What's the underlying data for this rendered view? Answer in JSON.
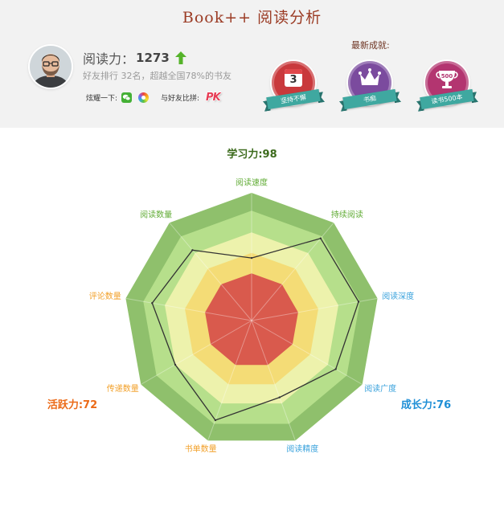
{
  "app": {
    "title": "Book++ 阅读分析"
  },
  "profile": {
    "avatar": "user-avatar-photo",
    "score_label": "阅读力：",
    "score_value": "1273",
    "trend_icon": "arrow-up-icon",
    "trend_color": "#55b32a",
    "rank_text": "好友排行 32名，超越全国78%的书友",
    "share_label": "炫耀一下:",
    "share_icons": [
      "wechat-icon",
      "moments-icon"
    ],
    "compare_label": "与好友比拼:",
    "compare_icon": "pk-icon",
    "compare_icon_text": "PK"
  },
  "achievements": {
    "heading": "最新成就:",
    "ribbon_color": "#3fa8a0",
    "badges": [
      {
        "label": "坚持不懈",
        "icon": "calendar-icon",
        "icon_text": "3",
        "color": "#c9393c"
      },
      {
        "label": "书痴",
        "icon": "crown-icon",
        "color": "#7b4b9e"
      },
      {
        "label": "读书500本",
        "icon": "trophy-icon",
        "icon_text": "500",
        "color": "#b33570"
      }
    ]
  },
  "chart_data": {
    "type": "radar",
    "categories": [
      "阅读速度",
      "持续阅读",
      "阅读深度",
      "阅读广度",
      "阅读精度",
      "书单数量",
      "传递数量",
      "评论数量",
      "阅读数量"
    ],
    "category_colors": [
      "#63ad38",
      "#63ad38",
      "#39a2dc",
      "#39a2dc",
      "#39a2dc",
      "#f2a12b",
      "#f2a12b",
      "#f2a12b",
      "#63ad38"
    ],
    "values": [
      49,
      84,
      85,
      76,
      64,
      83,
      69,
      79,
      72
    ],
    "range": [
      0,
      100
    ],
    "line_color": "#333333",
    "band_colors": [
      "#8fc06c",
      "#b6df8b",
      "#edf2ac",
      "#f4dc76",
      "#d95a4d"
    ],
    "grid": true,
    "group_labels": [
      {
        "text": "学习力:98",
        "color": "#3b6a1b"
      },
      {
        "text": "成长力:76",
        "color": "#1f8fd6"
      },
      {
        "text": "活跃力:72",
        "color": "#eb6a17"
      }
    ]
  }
}
